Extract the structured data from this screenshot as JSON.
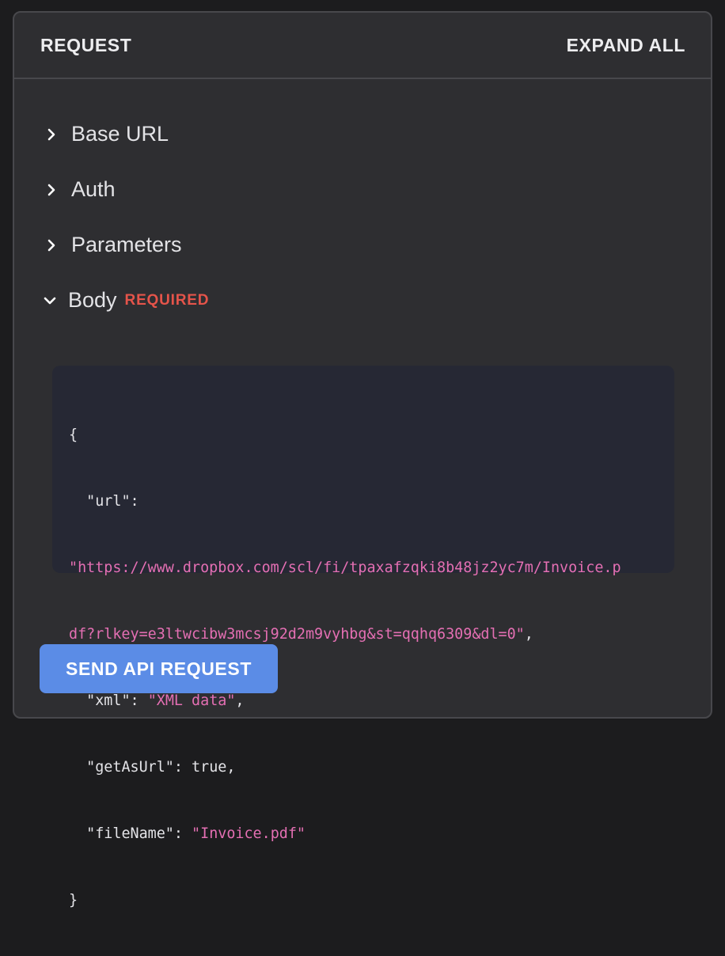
{
  "header": {
    "title": "REQUEST",
    "expand_all": "EXPAND ALL"
  },
  "sections": [
    {
      "label": "Base URL",
      "expanded": false,
      "icon": "chevron-right-icon"
    },
    {
      "label": "Auth",
      "expanded": false,
      "icon": "chevron-right-icon"
    },
    {
      "label": "Parameters",
      "expanded": false,
      "icon": "chevron-right-icon"
    },
    {
      "label": "Body",
      "expanded": true,
      "icon": "chevron-down-icon",
      "badge": "REQUIRED"
    }
  ],
  "body_code": {
    "open_brace": "{",
    "url_key": "\"url\"",
    "url_value_line1": "\"https://www.dropbox.com/scl/fi/tpaxafzqki8b48jz2yc7m/Invoice.p",
    "url_value_line2": "df?rlkey=e3ltwcibw3mcsj92d2m9vyhbg&st=qqhq6309&dl=0\"",
    "xml_key": "\"xml\"",
    "xml_value": "\"XML data\"",
    "getasurl_key": "\"getAsUrl\"",
    "getasurl_value": "true",
    "filename_key": "\"fileName\"",
    "filename_value": "\"Invoice.pdf\"",
    "close_brace": "}"
  },
  "send_button": {
    "label": "SEND API REQUEST"
  },
  "colors": {
    "panel_bg": "#2e2e31",
    "border": "#48484c",
    "code_bg": "#262834",
    "string": "#e46fb3",
    "badge": "#e5544a",
    "button": "#5b8ce6"
  }
}
